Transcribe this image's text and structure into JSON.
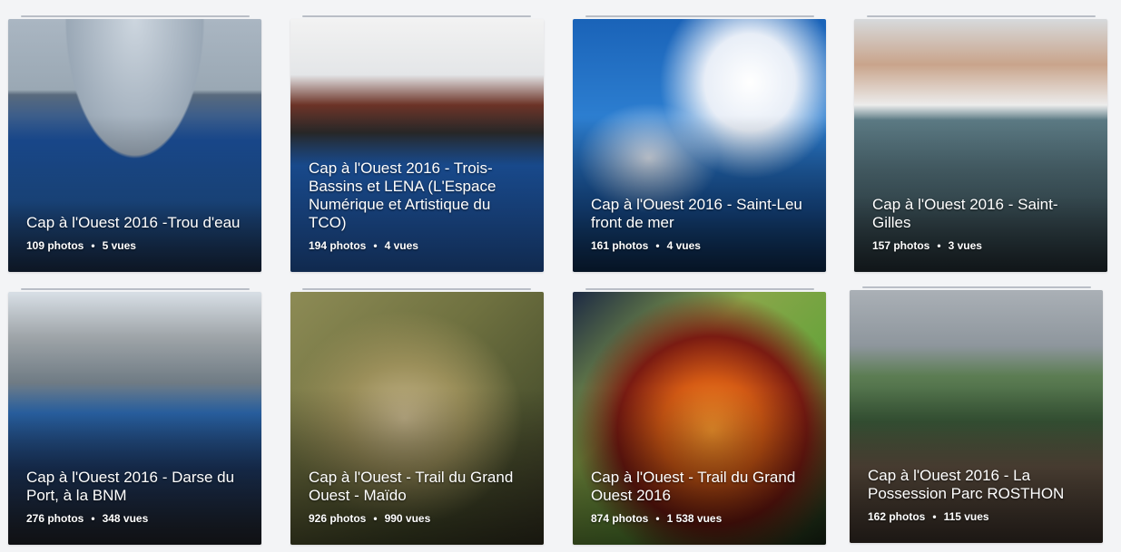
{
  "albums": [
    {
      "title": "Cap à l'Ouest 2016 -Trou d'eau",
      "photos": "109 photos",
      "views": "5 vues"
    },
    {
      "title": "Cap à l'Ouest 2016 - Trois-Bassins et LENA (L'Espace Numérique et Artistique du TCO)",
      "photos": "194 photos",
      "views": "4 vues"
    },
    {
      "title": "Cap à l'Ouest 2016 - Saint-Leu front de mer",
      "photos": "161 photos",
      "views": "4 vues"
    },
    {
      "title": "Cap à l'Ouest 2016 - Saint-Gilles",
      "photos": "157 photos",
      "views": "3 vues"
    },
    {
      "title": "Cap à l'Ouest 2016 - Darse du Port, à la BNM",
      "photos": "276 photos",
      "views": "348 vues"
    },
    {
      "title": "Cap à l'Ouest - Trail du Grand Ouest - Maïdo",
      "photos": "926 photos",
      "views": "990 vues"
    },
    {
      "title": "Cap à l'Ouest - Trail du Grand Ouest 2016",
      "photos": "874 photos",
      "views": "1 538 vues"
    },
    {
      "title": "Cap à l'Ouest 2016 - La Possession Parc ROSTHON",
      "photos": "162 photos",
      "views": "115 vues"
    }
  ],
  "separator": "•"
}
